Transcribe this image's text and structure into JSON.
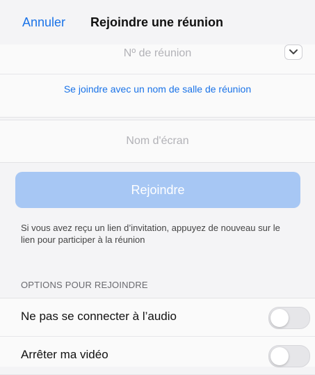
{
  "header": {
    "cancel_label": "Annuler",
    "title": "Rejoindre une réunion"
  },
  "meeting": {
    "placeholder": "Nº de réunion",
    "room_link_label": "Se joindre avec un nom de salle de réunion"
  },
  "screen_name": {
    "placeholder": "Nom d'écran"
  },
  "join_button": {
    "label": "Rejoindre",
    "color": "#a7c7f4"
  },
  "info_text": "Si vous avez reçu un lien d’invitation, appuyez de nouveau sur le lien pour participer à la réunion",
  "options": {
    "section_title": "OPTIONS POUR REJOINDRE",
    "items": [
      {
        "label": "Ne pas se connecter à l’audio",
        "enabled": false
      },
      {
        "label": "Arrêter ma vidéo",
        "enabled": false
      }
    ]
  },
  "colors": {
    "accent": "#1a73e8",
    "background": "#f4f4f6"
  }
}
